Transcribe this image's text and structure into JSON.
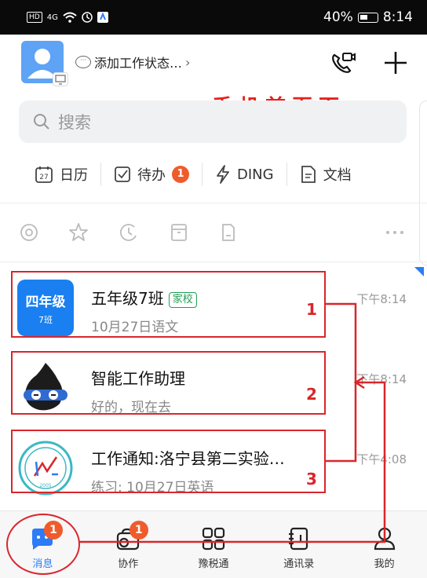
{
  "status_bar": {
    "left_label": "HD",
    "network": "4G",
    "battery": "40%",
    "time": "8:14"
  },
  "header": {
    "status_text": "添加工作状态…",
    "call_icon": "video-call-icon",
    "add_icon": "plus-icon"
  },
  "annotation": {
    "title": "手机首页面",
    "numbers": [
      "1",
      "2",
      "3"
    ]
  },
  "search": {
    "placeholder": "搜索"
  },
  "quickbar": {
    "items": [
      {
        "label": "日历",
        "icon": "calendar-icon",
        "icon_text": "27"
      },
      {
        "label": "待办",
        "icon": "todo-check-icon",
        "badge": "1"
      },
      {
        "label": "DING",
        "icon": "lightning-icon"
      },
      {
        "label": "文档",
        "icon": "document-icon"
      }
    ]
  },
  "filter_icons": [
    "at-icon",
    "star-icon",
    "clock-icon",
    "inbox-icon",
    "file-icon",
    "more-dots-icon"
  ],
  "conversations": [
    {
      "avatar_line1": "四年级",
      "avatar_line2": "7班",
      "title": "五年级7班",
      "tag": "家校",
      "subtitle": "10月27日语文",
      "time": "下午8:14"
    },
    {
      "title": "智能工作助理",
      "subtitle": "好的，现在去",
      "time": "下午8:14"
    },
    {
      "title": "工作通知:洛宁县第二实验…",
      "subtitle": "练习: 10月27日英语",
      "time": "下午4:08",
      "avatar_year": "2005"
    }
  ],
  "bottom_nav": [
    {
      "label": "消息",
      "icon": "chat-icon",
      "badge": "1",
      "active": true
    },
    {
      "label": "协作",
      "icon": "collab-icon",
      "badge": "1",
      "active": false
    },
    {
      "label": "豫税通",
      "icon": "grid-apps-icon",
      "active": false
    },
    {
      "label": "通讯录",
      "icon": "contacts-book-icon",
      "active": false
    },
    {
      "label": "我的",
      "icon": "person-icon",
      "active": false
    }
  ],
  "colors": {
    "accent": "#2b7cf6",
    "badge": "#f05b2b",
    "annotation_red": "#d9262b",
    "tag_green": "#20a052"
  }
}
